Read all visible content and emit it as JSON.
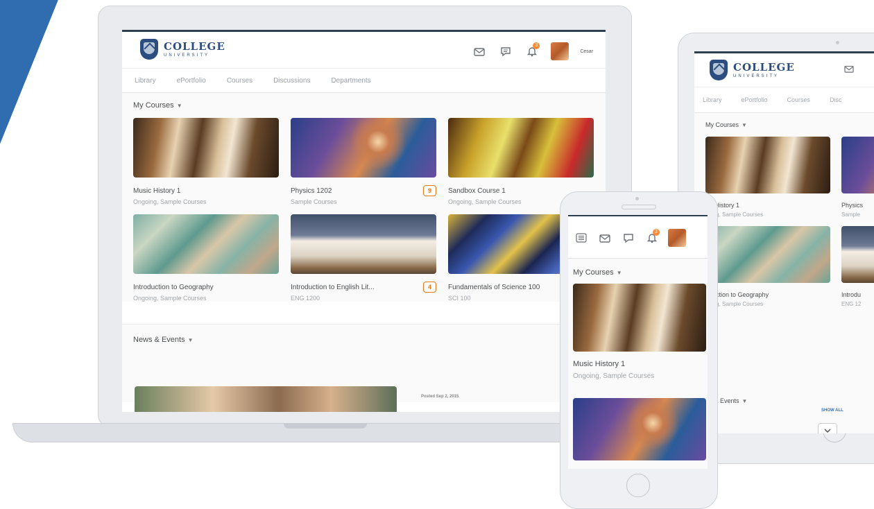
{
  "brand": {
    "name": "COLLEGE",
    "sub": "UNIVERSITY"
  },
  "header": {
    "user_name": "Cesar",
    "notification_count": "3"
  },
  "nav": [
    "Library",
    "ePortfolio",
    "Courses",
    "Discussions",
    "Departments"
  ],
  "tablet_nav": [
    "Library",
    "ePortfolio",
    "Courses",
    "Disc"
  ],
  "courses_section": {
    "title": "My Courses"
  },
  "courses": [
    {
      "title": "Music History 1",
      "sub": "Ongoing, Sample Courses",
      "count": "",
      "image": "music"
    },
    {
      "title": "Physics 1202",
      "sub": "Sample Courses",
      "count": "9",
      "image": "space"
    },
    {
      "title": "Sandbox Course 1",
      "sub": "Ongoing, Sample Courses",
      "count": "",
      "image": "paint"
    },
    {
      "title": "Introduction to Geography",
      "sub": "Ongoing, Sample Courses",
      "count": "",
      "image": "map"
    },
    {
      "title": "Introduction to English Lit...",
      "sub": "ENG 1200",
      "count": "4",
      "image": "book"
    },
    {
      "title": "Fundamentals of Science 100",
      "sub": "SCI 100",
      "count": "",
      "image": "calligraphy"
    }
  ],
  "tablet_courses": [
    {
      "title": "sic History 1",
      "sub": "going, Sample Courses"
    },
    {
      "title": "Physics",
      "sub": "Sample"
    },
    {
      "title": "oduction to Geography",
      "sub": "going, Sample Courses"
    },
    {
      "title": "Introdu",
      "sub": "ENG 12"
    }
  ],
  "tablet_show_all": "SHOW ALL",
  "tablet_news": "ws & Events",
  "news_section": {
    "title": "News & Events",
    "posted": "Posted Sep 2, 2015"
  },
  "phone": {
    "section_title": "My Courses",
    "course_title": "Music History 1",
    "course_sub": "Ongoing, Sample Courses"
  },
  "colors": {
    "stripe": "#2f6cb0",
    "brand": "#2c4d7f",
    "accent": "#e87511"
  }
}
